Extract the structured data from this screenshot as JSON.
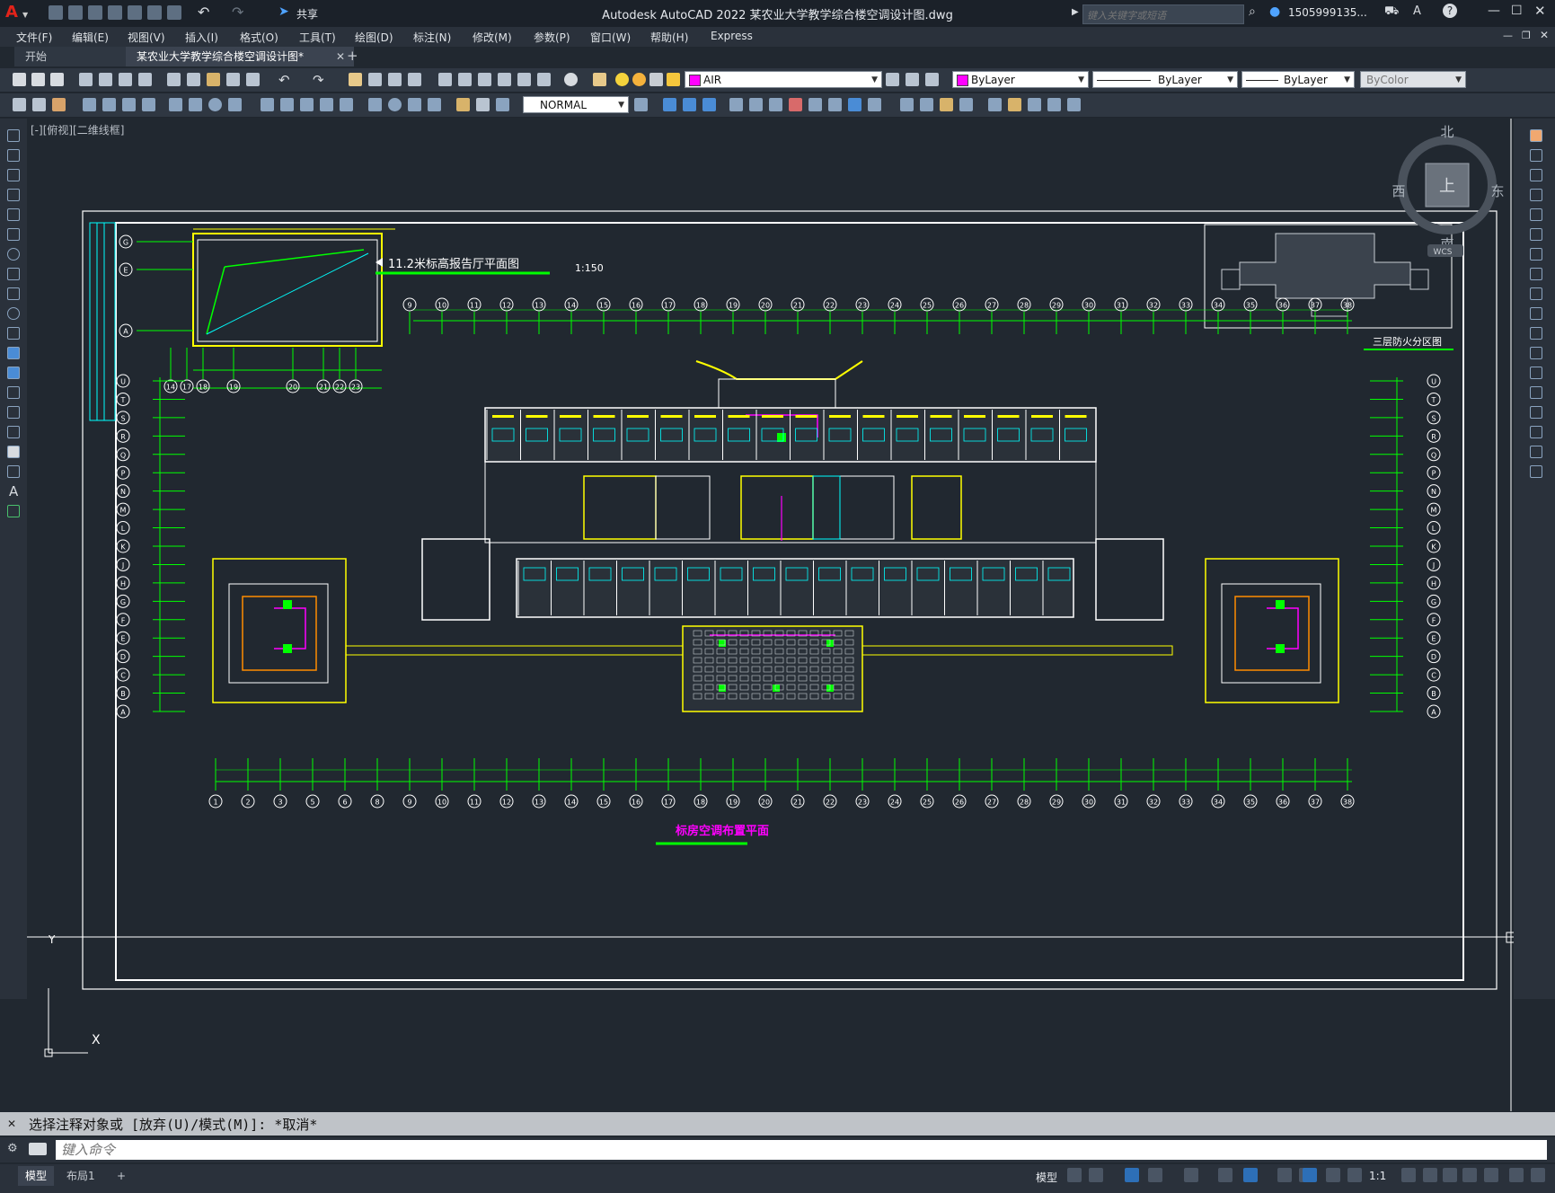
{
  "app": {
    "title": "Autodesk AutoCAD 2022    某农业大学教学综合楼空调设计图.dwg",
    "share_label": "共享",
    "search_placeholder": "键入关键字或短语",
    "user": "1505999135...",
    "logo_letter": "A"
  },
  "menu": [
    "文件(F)",
    "编辑(E)",
    "视图(V)",
    "插入(I)",
    "格式(O)",
    "工具(T)",
    "绘图(D)",
    "标注(N)",
    "修改(M)",
    "参数(P)",
    "窗口(W)",
    "帮助(H)",
    "Express"
  ],
  "tabs": {
    "start": "开始",
    "doc": "某农业大学教学综合楼空调设计图*",
    "close": "✕",
    "add": "+"
  },
  "toolbar": {
    "layer": "AIR",
    "color": "ByLayer",
    "linetype": "ByLayer",
    "lineweight": "ByLayer",
    "plotstyle": "ByColor",
    "dimstyle": "NORMAL"
  },
  "viewport": {
    "label": "[-][俯视][二维线框]",
    "compass": {
      "north": "北",
      "south": "南",
      "east": "东",
      "west": "西",
      "center": "上",
      "wcs": "WCS"
    }
  },
  "drawing": {
    "subtitle": "11.2米标高报告厅平面图",
    "subtitle_scale": "1:150",
    "keyplan_label": "三层防火分区图",
    "main_title": "标房空调布置平面",
    "ucs_y": "Y",
    "ucs_x": "X",
    "column_axis_labels": [
      "1",
      "2",
      "3",
      "5",
      "6",
      "8",
      "9",
      "10",
      "11",
      "12",
      "13",
      "14",
      "15",
      "16",
      "17",
      "18",
      "19",
      "20",
      "21",
      "22",
      "23",
      "24",
      "25",
      "26",
      "27",
      "28",
      "29",
      "30",
      "31",
      "32",
      "33",
      "34",
      "35",
      "36",
      "37",
      "38"
    ],
    "row_axis_labels_left": [
      "U",
      "T",
      "S",
      "R",
      "Q",
      "P",
      "N",
      "M",
      "L",
      "K",
      "J",
      "H",
      "G",
      "F",
      "E",
      "D",
      "C",
      "B",
      "A"
    ],
    "inset_row_labels": [
      "G",
      "E",
      "A"
    ],
    "inset_col_labels": [
      "14",
      "17",
      "18",
      "19",
      "20",
      "21",
      "22",
      "23"
    ]
  },
  "command": {
    "history": "选择注释对象或 [放弃(U)/模式(M)]: *取消*",
    "placeholder": "键入命令"
  },
  "status": {
    "model_tab": "模型",
    "layout_tab": "布局1",
    "add": "+",
    "model_label": "模型",
    "scale": "1:1"
  }
}
